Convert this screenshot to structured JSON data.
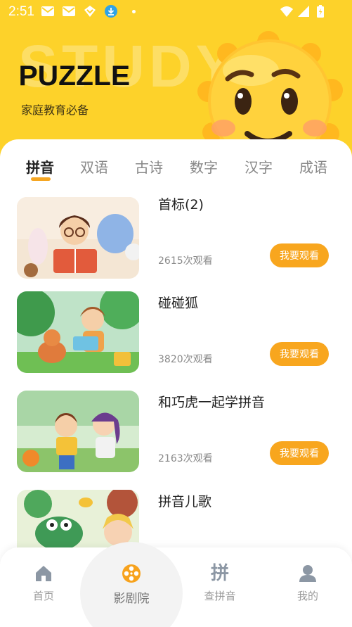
{
  "status_bar": {
    "time": "2:51"
  },
  "hero": {
    "watermark": "STUDY",
    "brand": "PUZZLE",
    "subtitle": "家庭教育必备"
  },
  "tabs": [
    {
      "label": "拼音",
      "active": true
    },
    {
      "label": "双语"
    },
    {
      "label": "古诗"
    },
    {
      "label": "数字"
    },
    {
      "label": "汉字"
    },
    {
      "label": "成语"
    }
  ],
  "videos": [
    {
      "title": "首标(2)",
      "views": "2615次观看",
      "button": "我要观看"
    },
    {
      "title": "碰碰狐",
      "views": "3820次观看",
      "button": "我要观看"
    },
    {
      "title": "和巧虎一起学拼音",
      "views": "2163次观看",
      "button": "我要观看"
    },
    {
      "title": "拼音儿歌"
    }
  ],
  "nav": [
    {
      "label": "首页",
      "icon": "home-icon"
    },
    {
      "label": "影剧院",
      "icon": "film-reel-icon",
      "active": true
    },
    {
      "label": "查拼音",
      "icon": "pinyin-icon",
      "glyph": "拼"
    },
    {
      "label": "我的",
      "icon": "user-icon"
    }
  ],
  "colors": {
    "hero": "#fdd22a",
    "accent": "#f8a61e",
    "tab_indicator": "#f5a623"
  }
}
